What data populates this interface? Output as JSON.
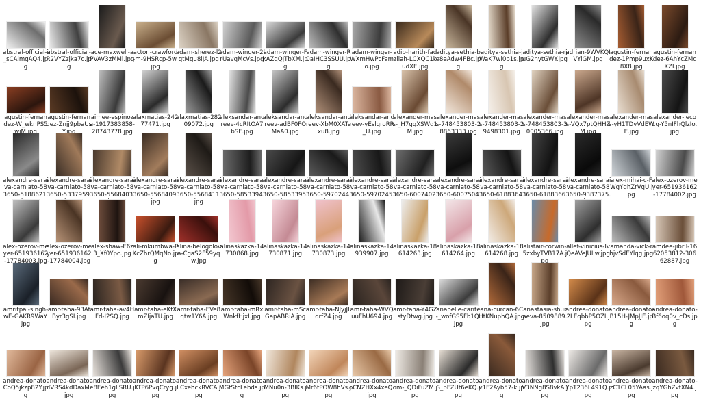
{
  "files": [
    {
      "name": "abstral-official-i_sCAlmgAQ4.jpg",
      "orientation": "landscape",
      "tone": [
        "#f0f0f0",
        "#6e6e6e"
      ]
    },
    {
      "name": "abstral-official-R2VYZzjka7c.jpg",
      "orientation": "landscape",
      "tone": [
        "#e9e9e9",
        "#404040"
      ]
    },
    {
      "name": "ace-maxwell-aPVAV3zMMl.jpg",
      "orientation": "portrait",
      "tone": [
        "#1c1c1c",
        "#6a5a4e"
      ]
    },
    {
      "name": "acton-crawford-m-9HSRcp-5w.jpg",
      "orientation": "landscape",
      "tone": [
        "#c9b08c",
        "#6b4d33"
      ]
    },
    {
      "name": "adam-sherez-l2qtMgu8lJA.jpg",
      "orientation": "landscape",
      "tone": [
        "#dcd2c4",
        "#8a7764"
      ]
    },
    {
      "name": "adam-winger-2lrUavqMcVs.jpg",
      "orientation": "landscape",
      "tone": [
        "#cfcfcf",
        "#5a5a5a"
      ]
    },
    {
      "name": "adam-winger-FkAZqQJTbXM.jpg",
      "orientation": "landscape",
      "tone": [
        "#d8d8d8",
        "#3a3a3a"
      ]
    },
    {
      "name": "adam-winger-R0aIHC3SSUU.jpg",
      "orientation": "landscape",
      "tone": [
        "#bcbcbc",
        "#2f2f2f"
      ]
    },
    {
      "name": "adam-winger-WXmHwPcFamo.jpg",
      "orientation": "landscape",
      "tone": [
        "#a8a8a8",
        "#3c3c3c"
      ]
    },
    {
      "name": "adib-harith-fadzilah-LCXQC1kudXE.jpg",
      "orientation": "landscape",
      "tone": [
        "#3a2a1c",
        "#b88a5a"
      ]
    },
    {
      "name": "aditya-sethia-be8eAdw4FBc.jpg",
      "orientation": "portrait",
      "tone": [
        "#c9b79d",
        "#4a3526"
      ]
    },
    {
      "name": "aditya-sethia-jWaK7wl0b1s.jpg",
      "orientation": "portrait",
      "tone": [
        "#e7ddce",
        "#5a3d28"
      ]
    },
    {
      "name": "aditya-sethia-rjuG2nytGWY.jpg",
      "orientation": "portrait",
      "tone": [
        "#e2e2e2",
        "#2e2e2e"
      ]
    },
    {
      "name": "adrian-9WVKQIVYiGM.jpg",
      "orientation": "portrait",
      "tone": [
        "#8c8c8c",
        "#2a2a2a"
      ]
    },
    {
      "name": "agustin-fernandez-1Pmp9uxK8X8.jpg",
      "orientation": "portrait",
      "tone": [
        "#a65d32",
        "#3a2418"
      ]
    },
    {
      "name": "agustin-fernandez-6AhYcZMcKZI.jpg",
      "orientation": "portrait",
      "tone": [
        "#7a4a2c",
        "#2c1b12"
      ]
    },
    {
      "name": "agustin-fernandez-W_wknPS5wjM.jpg",
      "orientation": "landscape",
      "tone": [
        "#8a3e22",
        "#2c160e"
      ]
    },
    {
      "name": "agustin-fernandez-Znjj9pbaUsY.jpg",
      "orientation": "landscape",
      "tone": [
        "#5a3a24",
        "#1c120c"
      ]
    },
    {
      "name": "aimee-espinoza-1917383858-28743778.jpg",
      "orientation": "portrait",
      "tone": [
        "#bdbdbd",
        "#3a3a3a"
      ]
    },
    {
      "name": "alaxmatias-24277471.jpg",
      "orientation": "portrait",
      "tone": [
        "#d0d0d0",
        "#2a2a2a"
      ]
    },
    {
      "name": "alaxmatias-28209072.jpg",
      "orientation": "portrait",
      "tone": [
        "#9a9a9a",
        "#1a1a1a"
      ]
    },
    {
      "name": "aleksandar-andreev-4cRItOA7bSE.jpg",
      "orientation": "portrait",
      "tone": [
        "#e2e2e2",
        "#4a4a4a"
      ]
    },
    {
      "name": "aleksandar-andreev-adBF0FOMaA0.jpg",
      "orientation": "portrait",
      "tone": [
        "#c4c4c4",
        "#2c2c2c"
      ]
    },
    {
      "name": "aleksandar-andreev-XbM0XATexu8.jpg",
      "orientation": "portrait",
      "tone": [
        "#b09079",
        "#3a2a20"
      ]
    },
    {
      "name": "aleksandar-andreev-yEslqroRR_U.jpg",
      "orientation": "landscape",
      "tone": [
        "#dcb7a0",
        "#8a5a42"
      ]
    },
    {
      "name": "alexander-mass-_H7gqXSWd1M.jpg",
      "orientation": "portrait",
      "tone": [
        "#d8c2aa",
        "#6a4a33"
      ]
    },
    {
      "name": "alexander-mass-748453803-28863333.jpg",
      "orientation": "portrait",
      "tone": [
        "#f2e7dc",
        "#b08a6a"
      ]
    },
    {
      "name": "alexander-mass-748453803-29498301.jpg",
      "orientation": "portrait",
      "tone": [
        "#f5f0ea",
        "#d8c6b2"
      ]
    },
    {
      "name": "alexander-mass-748453803-30005366.jpg",
      "orientation": "portrait",
      "tone": [
        "#e0d2c0",
        "#6a4e38"
      ]
    },
    {
      "name": "alexander-mass-VQx7ptQHHZM.jpg",
      "orientation": "portrait",
      "tone": [
        "#c9a78c",
        "#4e3526"
      ]
    },
    {
      "name": "alexander-mass-yH1TDvVdEWE.jpg",
      "orientation": "portrait",
      "tone": [
        "#e8ddd0",
        "#a88b70"
      ]
    },
    {
      "name": "alexander-lecocq-Y5nIFhQlzIo.jpg",
      "orientation": "portrait",
      "tone": [
        "#4a4a4a",
        "#141414"
      ]
    },
    {
      "name": "alexandre-saraiva-carniato-583650-5188621.jpg",
      "orientation": "portrait",
      "tone": [
        "#2a2a2a",
        "#8a8a8a"
      ]
    },
    {
      "name": "alexandre-saraiva-carniato-583650-5337959.jpg",
      "orientation": "portrait",
      "tone": [
        "#3a2e26",
        "#a07a5a"
      ]
    },
    {
      "name": "alexandre-saraiva-carniato-583650-5568403.jpg",
      "orientation": "landscape",
      "tone": [
        "#4a3a2e",
        "#b08a66"
      ]
    },
    {
      "name": "alexandre-saraiva-carniato-583650-5568409.jpg",
      "orientation": "portrait",
      "tone": [
        "#3c2e24",
        "#a27c5c"
      ]
    },
    {
      "name": "alexandre-saraiva-carniato-583650-5568411.jpg",
      "orientation": "portrait",
      "tone": [
        "#5a5048",
        "#1e1a16"
      ]
    },
    {
      "name": "alexandre-saraiva-carniato-583650-5853394.jpg",
      "orientation": "landscape",
      "tone": [
        "#6a6a6a",
        "#1e1e1e"
      ]
    },
    {
      "name": "alexandre-saraiva-carniato-583650-5853395.jpg",
      "orientation": "landscape",
      "tone": [
        "#4a4a4a",
        "#161616"
      ]
    },
    {
      "name": "alexandre-saraiva-carniato-583650-5970244.jpg",
      "orientation": "landscape",
      "tone": [
        "#5a5a5a",
        "#1a1a1a"
      ]
    },
    {
      "name": "alexandre-saraiva-carniato-583650-5970245.jpg",
      "orientation": "landscape",
      "tone": [
        "#4e4e4e",
        "#181818"
      ]
    },
    {
      "name": "alexandre-saraiva-carniato-583650-6007402.jpg",
      "orientation": "landscape",
      "tone": [
        "#6e6e6e",
        "#202020"
      ]
    },
    {
      "name": "alexandre-saraiva-carniato-583650-6007504.jpg",
      "orientation": "portrait",
      "tone": [
        "#3a3a3a",
        "#0e0e0e"
      ]
    },
    {
      "name": "alexandre-saraiva-carniato-583650-6188364.jpg",
      "orientation": "landscape",
      "tone": [
        "#5a5a5a",
        "#141414"
      ]
    },
    {
      "name": "alexandre-saraiva-carniato-583650-6188366.jpg",
      "orientation": "portrait",
      "tone": [
        "#444444",
        "#121212"
      ]
    },
    {
      "name": "alexandre-saraiva-carniato-583650-9387375.jpg",
      "orientation": "portrait",
      "tone": [
        "#2a2a2a",
        "#0a0a0a"
      ]
    },
    {
      "name": "alex-mihai-c-FWgYghZrVqU.jpg",
      "orientation": "landscape",
      "tone": [
        "#cfd4d8",
        "#5a6066"
      ]
    },
    {
      "name": "alex-ozerov-meyer-651936162-17784002.jpg",
      "orientation": "landscape",
      "tone": [
        "#d2d2d2",
        "#4a4a4a"
      ]
    },
    {
      "name": "alex-ozerov-meyer-651936162-17784003.jpg",
      "orientation": "portrait",
      "tone": [
        "#c0c0c0",
        "#3a3a3a"
      ]
    },
    {
      "name": "alex-ozerov-meyer-651936162-17784004.jpg",
      "orientation": "portrait",
      "tone": [
        "#b89478",
        "#4a3424"
      ]
    },
    {
      "name": "alex-shaw-E6z3_Xf0Ypc.jpg",
      "orientation": "portrait",
      "tone": [
        "#6a4a3a",
        "#1e1410"
      ]
    },
    {
      "name": "ali-mkumbwa-PKcZhrQMqNo.jpg",
      "orientation": "landscape",
      "tone": [
        "#c8502c",
        "#3a1a10"
      ]
    },
    {
      "name": "alina-belogolova-CgaS2F59yqw.jpg",
      "orientation": "landscape",
      "tone": [
        "#a0302a",
        "#3a100c"
      ]
    },
    {
      "name": "alinaskazka-14730868.jpg",
      "orientation": "portrait",
      "tone": [
        "#f2c6cf",
        "#e39aa8"
      ]
    },
    {
      "name": "alinaskazka-14730871.jpg",
      "orientation": "portrait",
      "tone": [
        "#f6d4db",
        "#c48a94"
      ]
    },
    {
      "name": "alinaskazka-14730873.jpg",
      "orientation": "portrait",
      "tone": [
        "#f0c2cc",
        "#d9a07a"
      ]
    },
    {
      "name": "alinaskazka-14939907.jpg",
      "orientation": "portrait",
      "tone": [
        "#1a1a1a",
        "#e8e8e8"
      ]
    },
    {
      "name": "alinaskazka-18614263.jpg",
      "orientation": "portrait",
      "tone": [
        "#ededed",
        "#c9a06a"
      ]
    },
    {
      "name": "alinaskazka-18614264.jpg",
      "orientation": "portrait",
      "tone": [
        "#f3e6e8",
        "#d8a0aa"
      ]
    },
    {
      "name": "alinaskazka-18614268.jpg",
      "orientation": "portrait",
      "tone": [
        "#f2ece6",
        "#cda87a"
      ]
    },
    {
      "name": "alistair-corwin-5zxbyTVB17A.jpg",
      "orientation": "portrait",
      "tone": [
        "#6a8aa8",
        "#c86a2a"
      ]
    },
    {
      "name": "allef-vinicius-IvQeAVeJULw.jpg",
      "orientation": "portrait",
      "tone": [
        "#a0a0a0",
        "#2e2e2e"
      ]
    },
    {
      "name": "amanda-vick-rhjvSdEYlqg.jpg",
      "orientation": "landscape",
      "tone": [
        "#bcbcbc",
        "#3a3a3a"
      ]
    },
    {
      "name": "amdee-jibril-1662053812-30662887.jpg",
      "orientation": "landscape",
      "tone": [
        "#d6c6b6",
        "#6a4e38"
      ]
    },
    {
      "name": "amritpal-singh-wE-GAKR9WaY.jpg",
      "orientation": "portrait",
      "tone": [
        "#5a6a7a",
        "#1a2028"
      ]
    },
    {
      "name": "amr-taha-93AfByr3gSI.jpg",
      "orientation": "landscape",
      "tone": [
        "#3a2a22",
        "#9a6a4a"
      ]
    },
    {
      "name": "amr-taha-av4HFd-I2SQ.jpg",
      "orientation": "landscape",
      "tone": [
        "#2a2420",
        "#7a5a44"
      ]
    },
    {
      "name": "amr-taha-eKfXmZIjaTU.jpg",
      "orientation": "landscape",
      "tone": [
        "#4a3a30",
        "#181210"
      ]
    },
    {
      "name": "amr-taha-EVe8qtw1Y6A.jpg",
      "orientation": "landscape",
      "tone": [
        "#3a2e28",
        "#8a6a52"
      ]
    },
    {
      "name": "amr-taha-mRxWnkfHjxI.jpg",
      "orientation": "landscape",
      "tone": [
        "#463628",
        "#120c08"
      ]
    },
    {
      "name": "amr-taha-mScGapABRiA.jpg",
      "orientation": "landscape",
      "tone": [
        "#2e2622",
        "#6a5242"
      ]
    },
    {
      "name": "amr-taha-NJyjJLdrfZ4.jpg",
      "orientation": "landscape",
      "tone": [
        "#3e2e24",
        "#a87a56"
      ]
    },
    {
      "name": "amr-taha-WVQuuFhU694.jpg",
      "orientation": "landscape",
      "tone": [
        "#2a2420",
        "#5a463a"
      ]
    },
    {
      "name": "amr-taha-Y4GZstyDtwg.jpg",
      "orientation": "landscape",
      "tone": [
        "#1e1a18",
        "#4a3e36"
      ]
    },
    {
      "name": "anabelle-carite-_wofGS5Fb1Q.jpg",
      "orientation": "landscape",
      "tone": [
        "#dadada",
        "#3c3c3c"
      ]
    },
    {
      "name": "ana-curcan-6CHtKNuphQA.jpg",
      "orientation": "portrait",
      "tone": [
        "#b06a3a",
        "#3a2418"
      ]
    },
    {
      "name": "anastasia-shuraeva-8509889.jpg",
      "orientation": "portrait",
      "tone": [
        "#c8a88a",
        "#5a3e2a"
      ]
    },
    {
      "name": "andrea-donato-2LEqbbP5OZI.jpg",
      "orientation": "landscape",
      "tone": [
        "#d28a4a",
        "#5a3218"
      ]
    },
    {
      "name": "andrea-donato-B15H-JMpJJE.jpg",
      "orientation": "landscape",
      "tone": [
        "#d8a88a",
        "#8a5a3e"
      ]
    },
    {
      "name": "andrea-donato-Bf6oq0v_cDs.jpg",
      "orientation": "landscape",
      "tone": [
        "#e2a07a",
        "#a0583a"
      ]
    },
    {
      "name": "andrea-donato-CoQ5jkzp82Y.jpg",
      "orientation": "landscape",
      "tone": [
        "#e0b89a",
        "#9a6444"
      ]
    },
    {
      "name": "andrea-donato-dVRS4kdDaxM.jpg",
      "orientation": "landscape",
      "tone": [
        "#ece4da",
        "#7a6656"
      ]
    },
    {
      "name": "andrea-donato-e8Eeh1gLSRU.jpg",
      "orientation": "landscape",
      "tone": [
        "#e8e2dc",
        "#3a3a3a"
      ]
    },
    {
      "name": "andrea-donato-KTP6PvqCryg.jpg",
      "orientation": "landscape",
      "tone": [
        "#d89a6a",
        "#5a3420"
      ]
    },
    {
      "name": "andrea-donato-LCxehckRVCA.jpg",
      "orientation": "landscape",
      "tone": [
        "#cf8e62",
        "#6a3e22"
      ]
    },
    {
      "name": "andrea-donato-MGtStcLebds.jpg",
      "orientation": "landscape",
      "tone": [
        "#e6a47c",
        "#7a4428"
      ]
    },
    {
      "name": "andrea-donato-MNu0n-3BIKs.jpg",
      "orientation": "landscape",
      "tone": [
        "#f0e6da",
        "#b0865e"
      ]
    },
    {
      "name": "andrea-donato-Mr6tPOW8hVs.jpg",
      "orientation": "landscape",
      "tone": [
        "#f2d4b8",
        "#c0865a"
      ]
    },
    {
      "name": "andrea-donato-oCNZHXx4xeQ.jpg",
      "orientation": "landscape",
      "tone": [
        "#e8c8a8",
        "#9a6a44"
      ]
    },
    {
      "name": "andrea-donato-om-_QDiFuZM.jpg",
      "orientation": "landscape",
      "tone": [
        "#eeeae4",
        "#8a8076"
      ]
    },
    {
      "name": "andrea-donato-S_pFZUt6eKQ.jpg",
      "orientation": "landscape",
      "tone": [
        "#e4dcd2",
        "#2a2a2a"
      ]
    },
    {
      "name": "andrea-donato-v1F2Ayb57-k.jpg",
      "orientation": "portrait",
      "tone": [
        "#3a2a20",
        "#8a5a3a"
      ]
    },
    {
      "name": "andrea-donato-V3NNg8S8vkA.jpg",
      "orientation": "landscape",
      "tone": [
        "#e6e2de",
        "#2e2e2e"
      ]
    },
    {
      "name": "andrea-donato-YpT236L491Q.jpg",
      "orientation": "landscape",
      "tone": [
        "#ece8e4",
        "#6a6a6a"
      ]
    },
    {
      "name": "andrea-donato-zC1CL05YAas.jpg",
      "orientation": "landscape",
      "tone": [
        "#c8b4a2",
        "#4a3a2e"
      ]
    },
    {
      "name": "andrea-donato-zqYGhZvfXN4.jpg",
      "orientation": "landscape",
      "tone": [
        "#3a2a20",
        "#7a5a40"
      ]
    }
  ]
}
